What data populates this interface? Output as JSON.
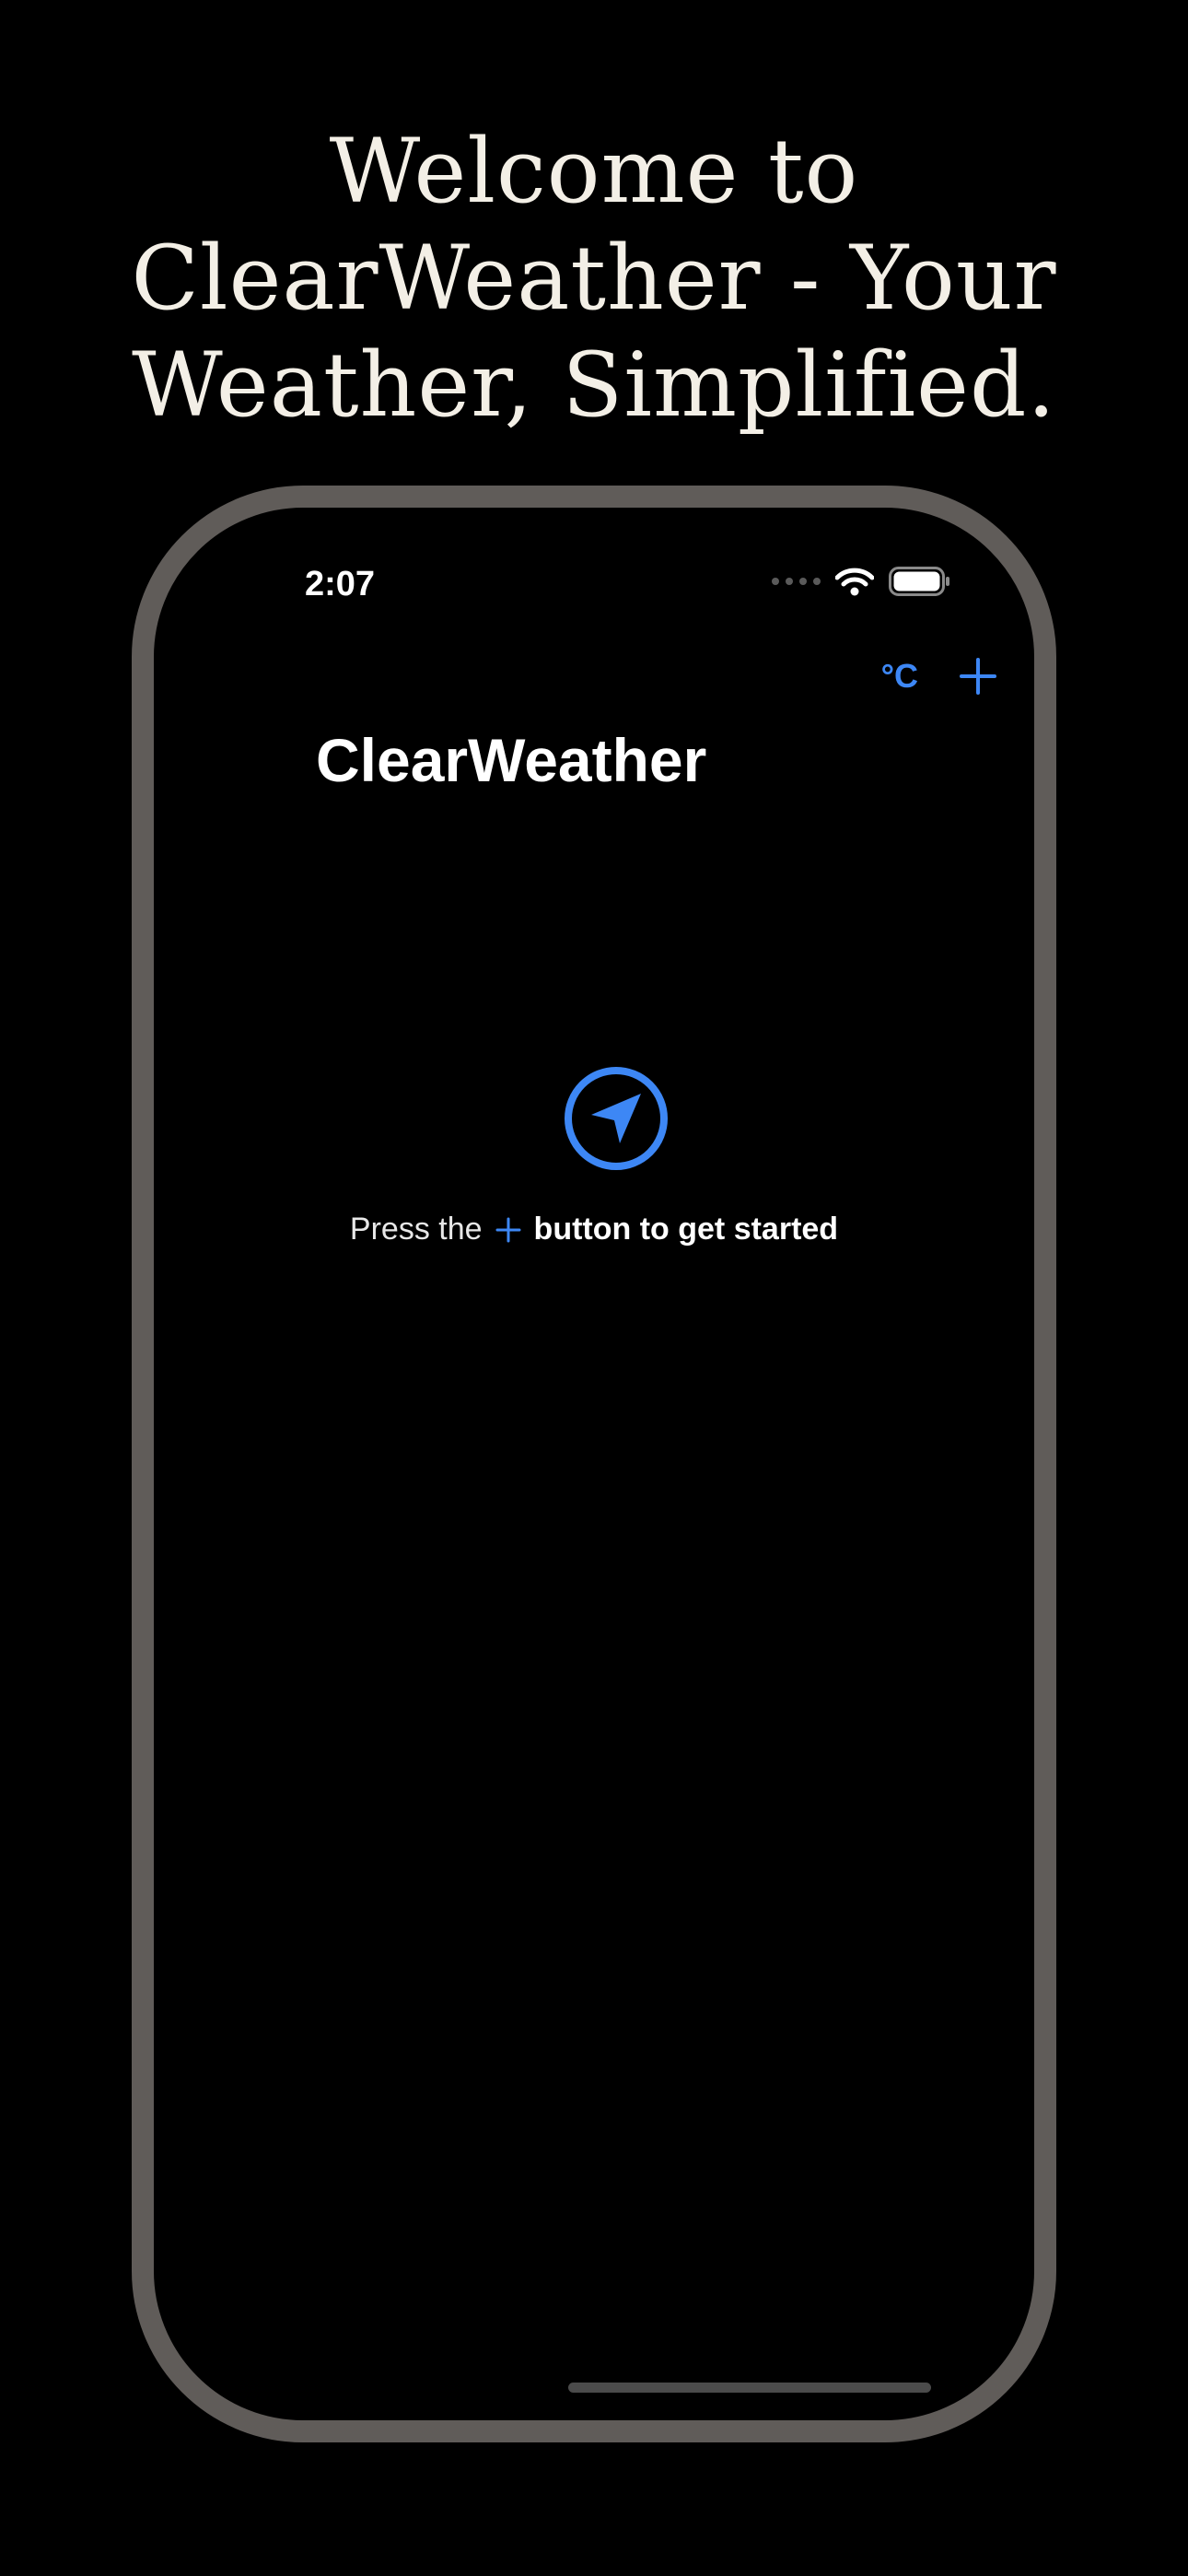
{
  "promo": {
    "line1": "Welcome to",
    "line2": "ClearWeather - Your",
    "line3": "Weather, Simplified."
  },
  "status_bar": {
    "time": "2:07",
    "icons": [
      "cellular-icon",
      "wifi-icon",
      "battery-icon"
    ]
  },
  "nav": {
    "unit_label": "°C",
    "add_icon": "plus-icon",
    "title": "ClearWeather"
  },
  "empty_state": {
    "icon": "location-arrow-icon",
    "text_before": "Press the",
    "inline_icon": "plus-icon",
    "text_after": "button to get started"
  },
  "colors": {
    "accent": "#3d87f5",
    "background": "#000000",
    "frame": "#605c59",
    "promo_text": "#f3efe6"
  }
}
